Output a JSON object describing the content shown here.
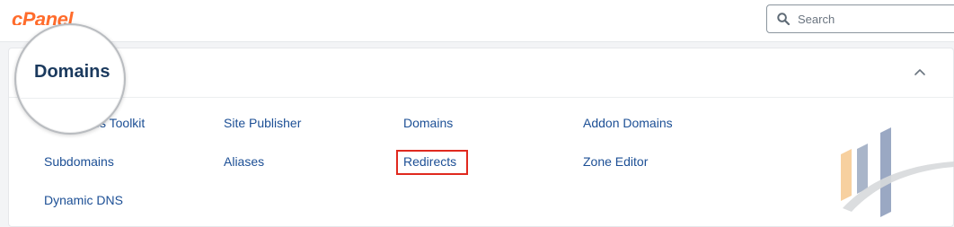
{
  "header": {
    "logo": "cPanel",
    "search": {
      "placeholder": "Search"
    }
  },
  "panel": {
    "title": "Domains",
    "collapse_icon": "chevron-up-icon",
    "items": [
      "WordPress Toolkit",
      "Site Publisher",
      "Domains",
      "Addon Domains",
      "Subdomains",
      "Aliases",
      "Redirects",
      "Zone Editor",
      "Dynamic DNS"
    ],
    "highlighted_item": "Redirects"
  },
  "colors": {
    "brand": "#ff6c2c",
    "link": "#1c4f95",
    "title": "#1b3a5e",
    "highlight": "#e0291e",
    "background": "#f3f4f6"
  }
}
